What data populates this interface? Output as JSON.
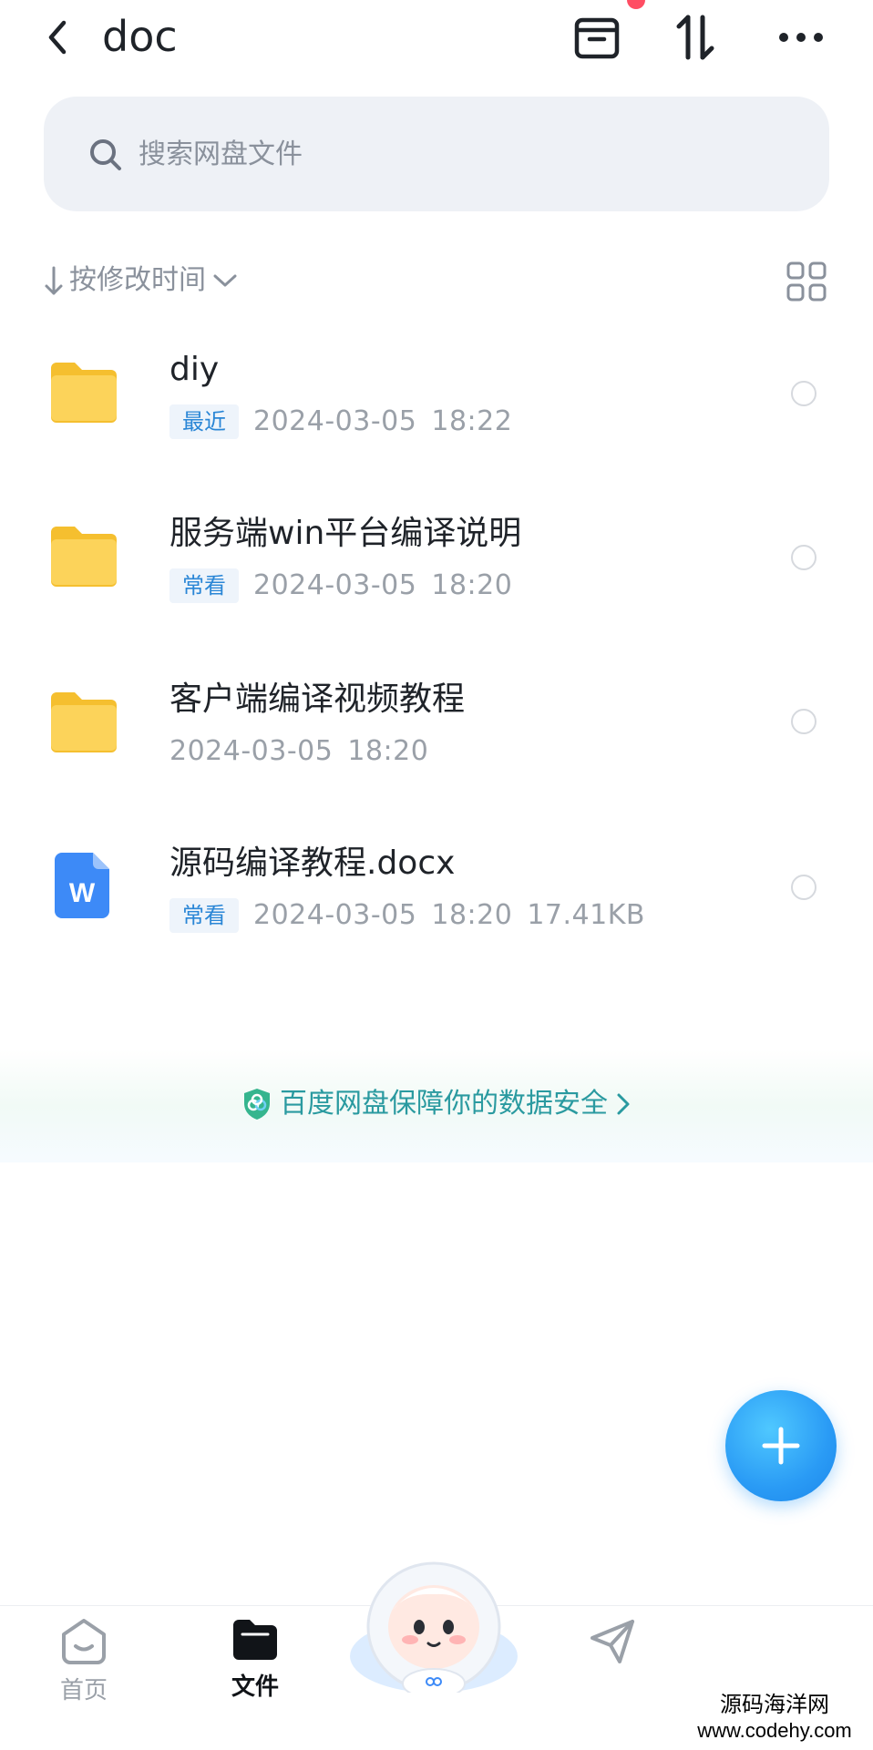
{
  "header": {
    "title": "doc",
    "icons": [
      "back-icon",
      "archive-icon",
      "transfer-sort-icon",
      "more-icon"
    ]
  },
  "search": {
    "placeholder": "搜索网盘文件"
  },
  "sort": {
    "label": "按修改时间"
  },
  "files": [
    {
      "name": "diy",
      "type": "folder",
      "tag": "最近",
      "date": "2024-03-05",
      "time": "18:22",
      "size": ""
    },
    {
      "name": "服务端win平台编译说明",
      "type": "folder",
      "tag": "常看",
      "date": "2024-03-05",
      "time": "18:20",
      "size": ""
    },
    {
      "name": "客户端编译视频教程",
      "type": "folder",
      "tag": "",
      "date": "2024-03-05",
      "time": "18:20",
      "size": ""
    },
    {
      "name": "源码编译教程.docx",
      "type": "word-doc",
      "tag": "常看",
      "date": "2024-03-05",
      "time": "18:20",
      "size": "17.41KB"
    }
  ],
  "banner": {
    "text": "百度网盘保障你的数据安全"
  },
  "nav": {
    "home": "首页",
    "files": "文件"
  },
  "watermark": {
    "line1": "源码海洋网",
    "line2": "www.codehy.com"
  },
  "colors": {
    "accent": "#2a9bf5",
    "tag_text": "#2a86d6",
    "folder": "#fcd35a",
    "banner_text": "#2a9aa0"
  }
}
